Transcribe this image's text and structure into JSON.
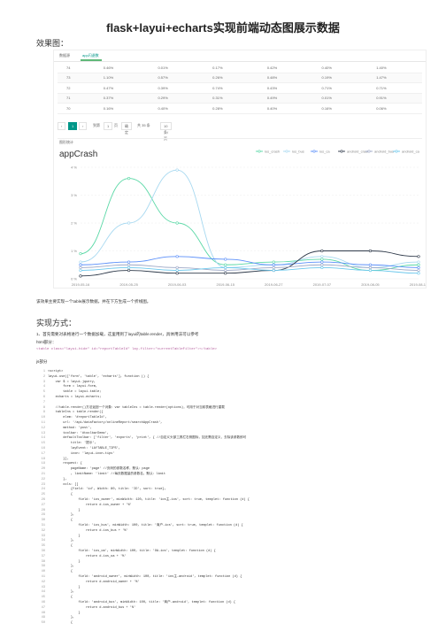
{
  "article": {
    "title": "flask+layui+echarts实现前端动态图展示数据",
    "effect_heading": "效果图：",
    "caption": "该效果主要实现一个table展示数据，并在下方生成一个折线图。",
    "impl_heading": "实现方式：",
    "step1": "1、首先需要对表格进行一个数据加载，这里用到了layui的table.render，具体用法可以参考",
    "html_label": "html部分：",
    "html_code": "<table class=\"layui-hide\" id=\"reportTableId\" lay-filter=\"currentTableFilter\"></table>",
    "js_label": "js部分"
  },
  "screenshot": {
    "tabs": [
      {
        "label": "数据源",
        "active": false
      },
      {
        "label": "app闪退数",
        "active": true
      }
    ],
    "table_rows": [
      [
        "74",
        "0.46%",
        "0.01%",
        "0.17%",
        "0.42%",
        "0.40%",
        "1.40%"
      ],
      [
        "73",
        "1.10%",
        "0.57%",
        "0.26%",
        "0.48%",
        "0.19%",
        "1.47%"
      ],
      [
        "72",
        "0.47%",
        "0.39%",
        "0.74%",
        "0.43%",
        "0.71%",
        "0.71%"
      ],
      [
        "71",
        "0.37%",
        "0.29%",
        "0.31%",
        "0.49%",
        "0.01%",
        "0.91%"
      ],
      [
        "70",
        "0.16%",
        "0.40%",
        "0.28%",
        "0.40%",
        "0.16%",
        "0.06%"
      ]
    ],
    "pager": {
      "pages": [
        "1"
      ],
      "goto_label": "到第",
      "page_input": "1",
      "page_unit": "页",
      "confirm": "确定",
      "total": "共 35 条",
      "per_page": "10 条/页"
    },
    "chart_section_label": "图形统计",
    "chart_data": {
      "type": "line",
      "title": "appCrash",
      "legend": [
        "ios_crash",
        "ios_bus",
        "ios_ca",
        "android_crash",
        "android_bus",
        "android_ca"
      ],
      "legend_position": "top-right",
      "colors": [
        "#5ad8a6",
        "#a6d8f0",
        "#5b8ff9",
        "#2f3a4a",
        "#9ea9c7",
        "#6dc8ec"
      ],
      "x": [
        "2019-05-16",
        "2019-05-25",
        "2019-06-03",
        "2019-06-15",
        "2019-06-27",
        "2019-07-07",
        "2019-08-05",
        "2019-08-17"
      ],
      "ylim": [
        0,
        4
      ],
      "y_ticks": [
        "0 %",
        "1 %",
        "2 %",
        "3 %",
        "4 %"
      ],
      "series": [
        {
          "name": "ios_crash",
          "values": [
            0.9,
            3.6,
            2.0,
            0.5,
            0.6,
            0.7,
            0.3,
            0.5
          ]
        },
        {
          "name": "ios_bus",
          "values": [
            0.6,
            2.0,
            3.9,
            0.4,
            0.5,
            0.8,
            0.4,
            0.6
          ]
        },
        {
          "name": "ios_ca",
          "values": [
            0.5,
            0.6,
            0.8,
            0.7,
            0.5,
            0.6,
            0.5,
            0.4
          ]
        },
        {
          "name": "android_crash",
          "values": [
            0.1,
            0.3,
            0.2,
            0.2,
            0.3,
            1.0,
            1.0,
            0.8
          ]
        },
        {
          "name": "android_bus",
          "values": [
            0.4,
            0.5,
            0.4,
            0.3,
            0.4,
            0.5,
            0.4,
            0.3
          ]
        },
        {
          "name": "android_ca",
          "values": [
            0.3,
            0.4,
            0.3,
            0.4,
            0.3,
            0.4,
            0.3,
            0.2
          ]
        }
      ]
    }
  },
  "code_lines": [
    {
      "n": "1",
      "text": "<script>"
    },
    {
      "n": "2",
      "text": "layui.use(['form', 'table', 'echarts'], function () {"
    },
    {
      "n": "3",
      "text": "    var $ = layui.jquery,"
    },
    {
      "n": "4",
      "text": "        form = layui.form,"
    },
    {
      "n": "5",
      "text": "        table = layui.table;"
    },
    {
      "n": "6",
      "text": "    echarts = layui.echarts;"
    },
    {
      "n": "7",
      "text": ""
    },
    {
      "n": "8",
      "text": "    //table.render()方法返回一个对象：var tableIns = table.render(options)，可用于对当前表格进行重载"
    },
    {
      "n": "9",
      "text": "    tableIns = table.render({"
    },
    {
      "n": "10",
      "text": "        elem: '#reportTableId',"
    },
    {
      "n": "11",
      "text": "        url: '/api/dataFactory/onlineReport/searchAppCrash',"
    },
    {
      "n": "12",
      "text": "        method: 'post',"
    },
    {
      "n": "13",
      "text": "        toolbar: '#toolbarDemo',"
    },
    {
      "n": "14",
      "text": "        defaultToolbar: ['filter', 'exports', 'print', { //自定义头部工具栏右侧图标，如无需自定义，去除该参数即可"
    },
    {
      "n": "15",
      "text": "            title: '提示',"
    },
    {
      "n": "16",
      "text": "            layEvent: 'LAYTABLE_TIPS',"
    },
    {
      "n": "17",
      "text": "            icon: 'layui-icon-tips'"
    },
    {
      "n": "18",
      "text": "        }],"
    },
    {
      "n": "19",
      "text": "        request: {"
    },
    {
      "n": "20",
      "text": "            pageName: 'page' //页码的参数名称，默认：page"
    },
    {
      "n": "21",
      "text": "            , limitName: 'limit' //每页数据量的参数名，默认：limit"
    },
    {
      "n": "22",
      "text": "        },"
    },
    {
      "n": "23",
      "text": "        cols: [["
    },
    {
      "n": "24",
      "text": "            {field: 'id', Width: 80, title: 'ID', sort: true},"
    },
    {
      "n": "25",
      "text": "            {"
    },
    {
      "n": "26",
      "text": "                field: 'ios_owner', minWidth: 120, title: 'ios主-ios', sort: true, templet: function (d) {"
    },
    {
      "n": "27",
      "text": "                    return d.ios_owner + '%'"
    },
    {
      "n": "28",
      "text": "                }"
    },
    {
      "n": "29",
      "text": "            },"
    },
    {
      "n": "30",
      "text": "            {"
    },
    {
      "n": "31",
      "text": "                field: 'ios_bus', minWidth: 100, title: '商户-ios', sort: true, templet: function (d) {"
    },
    {
      "n": "32",
      "text": "                    return d.ios_bus + '%'"
    },
    {
      "n": "33",
      "text": "                }"
    },
    {
      "n": "34",
      "text": "            },"
    },
    {
      "n": "35",
      "text": "            {"
    },
    {
      "n": "36",
      "text": "                field: 'ios_oa', minWidth: 100, title: 'OA-ios', templet: function (d) {"
    },
    {
      "n": "37",
      "text": "                    return d.ios_oa + '%'"
    },
    {
      "n": "38",
      "text": "                }"
    },
    {
      "n": "39",
      "text": "            },"
    },
    {
      "n": "40",
      "text": "            {"
    },
    {
      "n": "41",
      "text": "                field: 'android_owner', minWidth: 100, title: 'ios主-android', templet: function (d) {"
    },
    {
      "n": "42",
      "text": "                    return d.android_owner + '%'"
    },
    {
      "n": "43",
      "text": "                }"
    },
    {
      "n": "44",
      "text": "            },"
    },
    {
      "n": "45",
      "text": "            {"
    },
    {
      "n": "46",
      "text": "                field: 'android_bus', minWidth: 100, title: '商户-android', templet: function (d) {"
    },
    {
      "n": "47",
      "text": "                    return d.android_bus + '%'"
    },
    {
      "n": "48",
      "text": "                }"
    },
    {
      "n": "49",
      "text": "            },"
    },
    {
      "n": "50",
      "text": "            {"
    }
  ]
}
